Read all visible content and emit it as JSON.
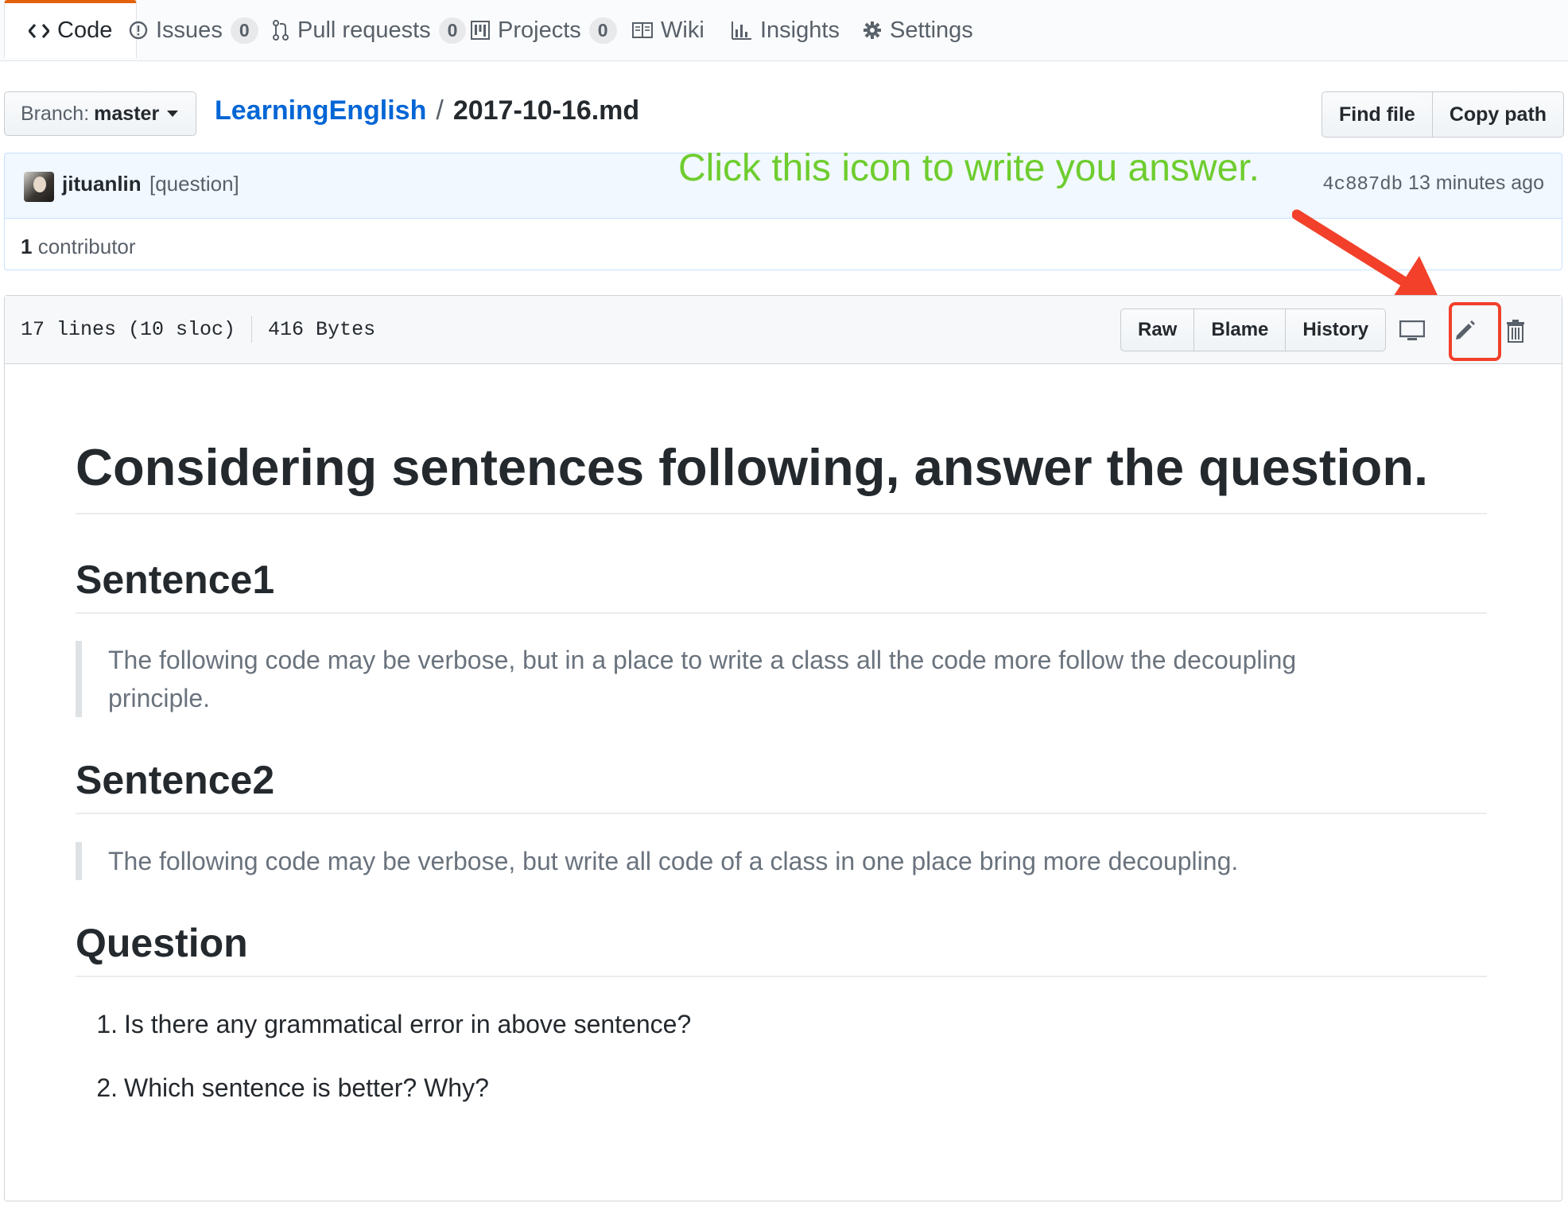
{
  "tabs": [
    {
      "label": "Code",
      "icon": "code-icon"
    },
    {
      "label": "Issues",
      "count": "0",
      "icon": "issue-icon"
    },
    {
      "label": "Pull requests",
      "count": "0",
      "icon": "pull-request-icon"
    },
    {
      "label": "Projects",
      "count": "0",
      "icon": "project-icon"
    },
    {
      "label": "Wiki",
      "icon": "book-icon"
    },
    {
      "label": "Insights",
      "icon": "graph-icon"
    },
    {
      "label": "Settings",
      "icon": "gear-icon"
    }
  ],
  "branch": {
    "label": "Branch:",
    "value": "master"
  },
  "breadcrumb": {
    "repo": "LearningEnglish",
    "separator": "/",
    "file": "2017-10-16.md"
  },
  "file_nav": {
    "find_file": "Find file",
    "copy_path": "Copy path"
  },
  "commit": {
    "author": "jituanlin",
    "message": "[question]",
    "sha": "4c887db",
    "time": "13 minutes ago"
  },
  "contributors": {
    "count": "1",
    "label": "contributor"
  },
  "annotation": {
    "text": "Click this icon to write you answer.",
    "color": "#6ecd2e",
    "arrow_color": "#f2402a"
  },
  "file_info": {
    "lines": "17 lines (10 sloc)",
    "size": "416 Bytes"
  },
  "file_actions": {
    "raw": "Raw",
    "blame": "Blame",
    "history": "History"
  },
  "file_icons": [
    "desktop-icon",
    "pencil-icon",
    "trashcan-icon"
  ],
  "content": {
    "title": "Considering sentences following, answer the question.",
    "sentence1_heading": "Sentence1",
    "sentence1_line1": "The following code may be verbose, but in a place to write a class all the code more follow the decoupling",
    "sentence1_line2": "principle.",
    "sentence2_heading": "Sentence2",
    "sentence2": "The following code may be verbose, but write all code of a class in one place bring more decoupling.",
    "question_heading": "Question",
    "questions": [
      {
        "num": "1.",
        "text": "Is there any grammatical error in above sentence?"
      },
      {
        "num": "2.",
        "text": "Which sentence is better? Why?"
      }
    ]
  }
}
